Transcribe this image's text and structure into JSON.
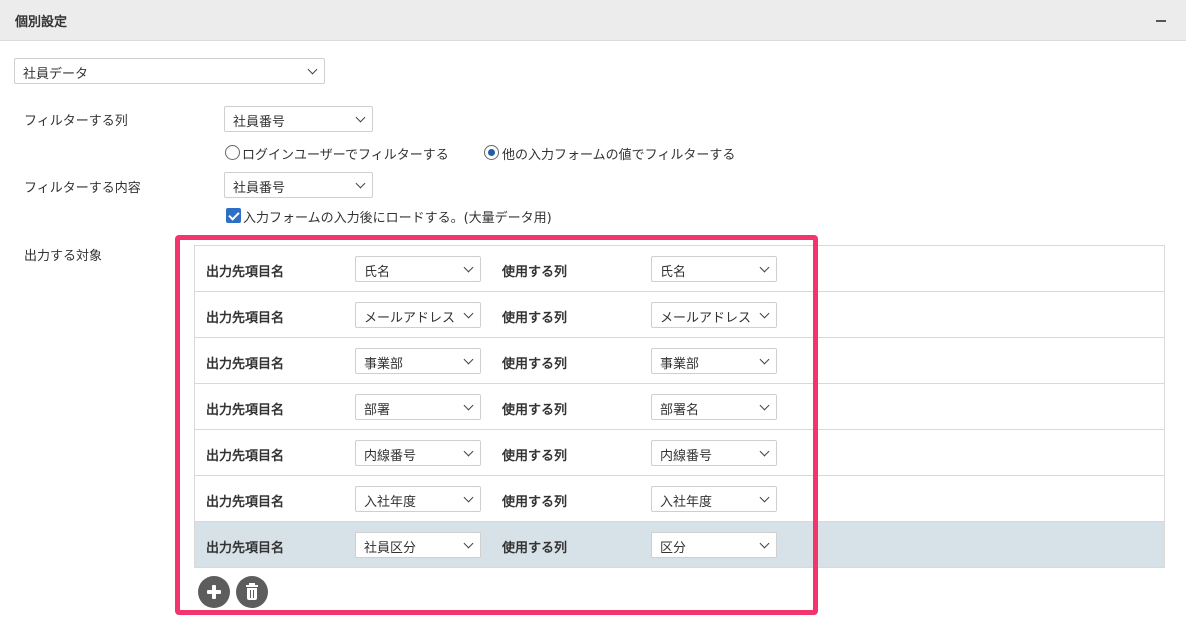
{
  "panel": {
    "title": "個別設定"
  },
  "datasource": {
    "value": "社員データ"
  },
  "filter_column": {
    "label": "フィルターする列",
    "value": "社員番号"
  },
  "filter_mode": {
    "option1": "ログインユーザーでフィルターする",
    "option2": "他の入力フォームの値でフィルターする",
    "selected": "option2"
  },
  "filter_content": {
    "label": "フィルターする内容",
    "value": "社員番号"
  },
  "lazy_load": {
    "label": "入力フォームの入力後にロードする。(大量データ用)",
    "checked": true
  },
  "output": {
    "label": "出力する対象",
    "dest_label": "出力先項目名",
    "col_label": "使用する列",
    "rows": [
      {
        "dest": "氏名",
        "col": "氏名"
      },
      {
        "dest": "メールアドレス",
        "col": "メールアドレス"
      },
      {
        "dest": "事業部",
        "col": "事業部"
      },
      {
        "dest": "部署",
        "col": "部署名"
      },
      {
        "dest": "内線番号",
        "col": "内線番号"
      },
      {
        "dest": "入社年度",
        "col": "入社年度"
      },
      {
        "dest": "社員区分",
        "col": "区分"
      }
    ],
    "selected_row": 6
  },
  "colors": {
    "highlight": "#f2356c",
    "selected_row": "#d7e1e8",
    "radio_dot": "#1f5fa8",
    "checkbox": "#2c6fc7"
  },
  "icons": {
    "add": "plus-icon",
    "delete": "trash-icon",
    "collapse": "minus-icon"
  }
}
